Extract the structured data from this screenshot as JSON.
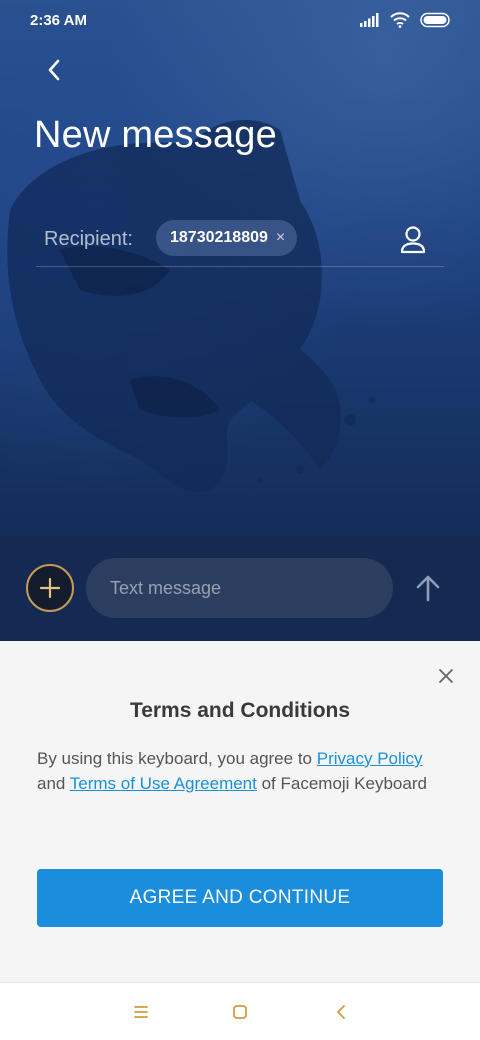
{
  "status_bar": {
    "time": "2:36 AM",
    "icons": [
      "signal-icon",
      "wifi-icon",
      "battery-icon"
    ]
  },
  "header": {
    "back_icon": "back-arrow-icon",
    "title": "New message"
  },
  "recipient": {
    "label": "Recipient:",
    "chip_value": "18730218809",
    "chip_remove_glyph": "×",
    "contact_icon": "contact-icon"
  },
  "compose": {
    "attach_icon": "plus-icon",
    "placeholder": "Text message",
    "send_icon": "send-arrow-icon"
  },
  "terms": {
    "close_icon": "close-icon",
    "title": "Terms and Conditions",
    "body_prefix": "By using this keyboard, you agree to ",
    "privacy_link": "Privacy Policy",
    "body_middle": " and ",
    "terms_link": "Terms of Use Agreement",
    "body_suffix": " of Facemoji Keyboard",
    "agree_button": "AGREE AND CONTINUE"
  },
  "nav_bar": {
    "icons": [
      "menu-icon",
      "home-icon",
      "back-icon"
    ]
  },
  "colors": {
    "accent": "#1a8ddc",
    "link": "#1a90d9",
    "nav_icon": "#d89a3c",
    "attach_border": "#c59a57",
    "wallpaper": "#1e4282"
  }
}
